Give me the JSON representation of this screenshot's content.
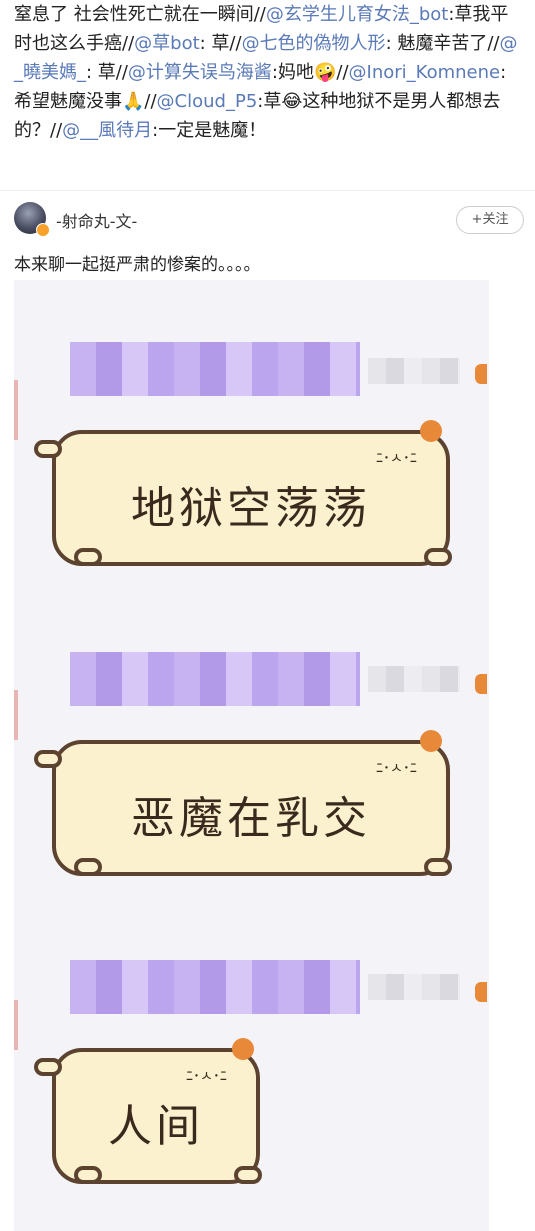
{
  "repost_text_segments": [
    {
      "text": "窒息了 社会性死亡就在一瞬间//",
      "link": false
    },
    {
      "text": "@玄学生儿育女法_bot",
      "link": true
    },
    {
      "text": ":草我平时也这么手癌//",
      "link": false
    },
    {
      "text": "@草bot",
      "link": true
    },
    {
      "text": ": 草//",
      "link": false
    },
    {
      "text": "@七色的偽物人形",
      "link": true
    },
    {
      "text": ": 魅魔辛苦了//",
      "link": false
    },
    {
      "text": "@_曉美媽_",
      "link": true
    },
    {
      "text": ": 草//",
      "link": false
    },
    {
      "text": "@计算失误鸟海酱",
      "link": true
    },
    {
      "text": ":妈吔🤪//",
      "link": false
    },
    {
      "text": "@Inori_Komnene",
      "link": true
    },
    {
      "text": ": 希望魅魔没事🙏//",
      "link": false
    },
    {
      "text": "@Cloud_P5",
      "link": true
    },
    {
      "text": ":草😂这种地狱不是男人都想去的？//",
      "link": false
    },
    {
      "text": "@__風待月",
      "link": true
    },
    {
      "text": ":一定是魅魔！",
      "link": false
    }
  ],
  "author": {
    "name": "-射命丸-文-",
    "follow_label": "+关注"
  },
  "post_text": "本来聊一起挺严肃的惨案的。。。。",
  "bubbles": [
    {
      "text": "地狱空荡荡"
    },
    {
      "text": "恶魔在乳交"
    },
    {
      "text": "人间"
    }
  ],
  "icons": {
    "avatar": "user-avatar",
    "badge": "verified-badge",
    "cat": "cat-sticker-icon"
  },
  "colors": {
    "link": "#5a7ab8",
    "bubble_fill": "#fcf1cf",
    "bubble_border": "#5b4330",
    "cat_orange": "#e8893a",
    "pixel_purple": "#c7b2f2"
  }
}
